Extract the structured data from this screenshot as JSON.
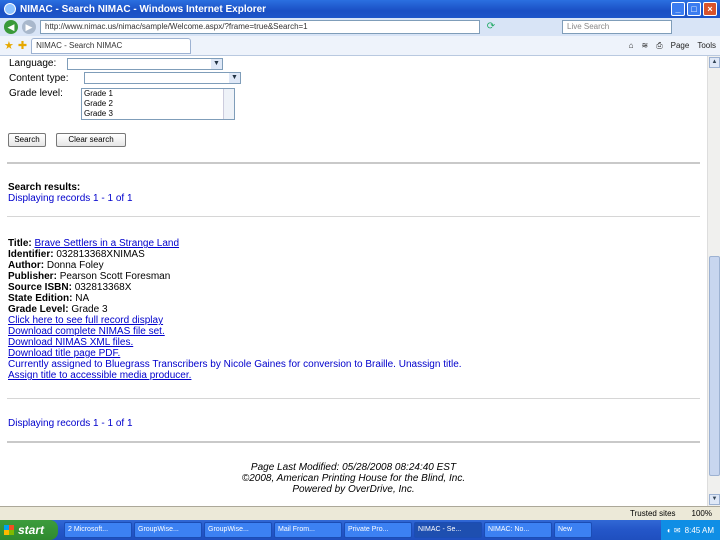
{
  "window": {
    "title": "NIMAC - Search NIMAC - Windows Internet Explorer",
    "address": "http://www.nimac.us/nimac/sample/Welcome.aspx/?frame=true&Search=1",
    "search_placeholder": "Live Search",
    "tab_label": "NIMAC - Search NIMAC",
    "cmd_page": "Page",
    "cmd_tools": "Tools"
  },
  "form": {
    "language_label": "Language:",
    "content_type_label": "Content type:",
    "grade_level_label": "Grade level:",
    "grade_options": [
      "Grade 1",
      "Grade 2",
      "Grade 3"
    ],
    "search_button": "Search",
    "clear_button": "Clear search"
  },
  "results": {
    "heading": "Search results:",
    "displaying_top": "Displaying records 1 - 1 of 1",
    "displaying_bottom": "Displaying records 1 - 1 of 1",
    "record": {
      "title_label": "Title:",
      "title_value": "Brave Settlers in a Strange Land",
      "identifier_label": "Identifier:",
      "identifier_value": "032813368XNIMAS",
      "author_label": "Author:",
      "author_value": "Donna Foley",
      "publisher_label": "Publisher:",
      "publisher_value": "Pearson Scott Foresman",
      "source_label": "Source ISBN:",
      "source_value": "032813368X",
      "state_label": "State Edition:",
      "state_value": "NA",
      "grade_label": "Grade Level:",
      "grade_value": "Grade 3",
      "link_full_record": "Click here to see full record display",
      "link_download_set": "Download complete NIMAS file set.",
      "link_download_xml": "Download NIMAS XML files.",
      "link_download_pdf": "Download title page PDF.",
      "assigned_text": "Currently assigned to Bluegrass Transcribers by Nicole Gaines for conversion to Braille.",
      "unassign_link": "Unassign title.",
      "assign_link": "Assign title to accessible media producer."
    }
  },
  "footer": {
    "line1": "Page Last Modified: 05/28/2008 08:24:40 EST",
    "line2": "©2008, American Printing House for the Blind, Inc.",
    "line3": "Powered by OverDrive, Inc."
  },
  "statusbar": {
    "zone": "Trusted sites",
    "zoom": "100%"
  },
  "taskbar": {
    "start": "start",
    "tasks": [
      "2 Microsoft...",
      "GroupWise...",
      "GroupWise...",
      "Mail From...",
      "Private Pro...",
      "NIMAC - Se...",
      "NIMAC: No...",
      "New"
    ],
    "clock": "8:45 AM"
  },
  "colors": {
    "link": "#0000cc",
    "taskbar": "#2456c8",
    "start": "#3c9c3c"
  }
}
